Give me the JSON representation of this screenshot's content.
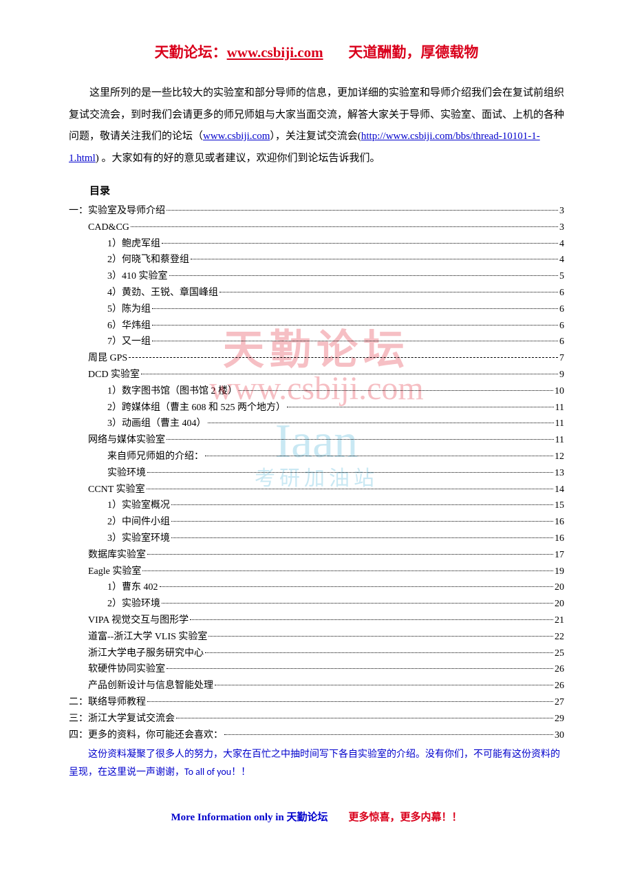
{
  "header": {
    "prefix": "天勤论坛：",
    "link_text": "www.csbiji.com",
    "motto": "天道酬勤，厚德载物"
  },
  "intro": {
    "text1": "这里所列的是一些比较大的实验室和部分导师的信息，更加详细的实验室和导师介绍我们会在复试前组织复试交流会，到时我们会请更多的师兄师姐与大家当面交流，解答大家关于导师、实验室、面试、上机的各种问题，敬请关注我们的论坛（",
    "link1": "www.csbiji.com",
    "text2": "），关注复试交流会(",
    "link2": "http://www.csbiji.com/bbs/thread-10101-1-1.html",
    "text3": ")  。大家如有的好的意见或者建议，欢迎你们到论坛告诉我们。"
  },
  "toc_title": "目录",
  "toc": [
    {
      "level": 0,
      "label": "一：实验室及导师介绍",
      "page": "3",
      "leader": "dot"
    },
    {
      "level": 1,
      "label": "CAD&CG",
      "page": "3",
      "leader": "dot"
    },
    {
      "level": 2,
      "label": "1）鲍虎军组",
      "page": "4",
      "leader": "dot"
    },
    {
      "level": 2,
      "label": "2）何晓飞和蔡登组",
      "page": "4",
      "leader": "dot"
    },
    {
      "level": 2,
      "label": "3）410 实验室",
      "page": "5",
      "leader": "dot"
    },
    {
      "level": 2,
      "label": "4）黄劲、王锐、章国峰组",
      "page": "6",
      "leader": "dot"
    },
    {
      "level": 2,
      "label": "5）陈为组",
      "page": "6",
      "leader": "dot"
    },
    {
      "level": 2,
      "label": "6）华炜组",
      "page": "6",
      "leader": "dot"
    },
    {
      "level": 2,
      "label": "7）又一组",
      "page": "6",
      "leader": "dot"
    },
    {
      "level": 1,
      "label": "周昆 GPS",
      "page": "7",
      "leader": "dash"
    },
    {
      "level": 1,
      "label": "DCD 实验室",
      "page": "9",
      "leader": "dot"
    },
    {
      "level": 2,
      "label": "1）数字图书馆（图书馆 2 楼）",
      "page": "10",
      "leader": "dot"
    },
    {
      "level": 2,
      "label": "2）跨媒体组（曹主 608 和 525 两个地方）",
      "page": "11",
      "leader": "dot"
    },
    {
      "level": 2,
      "label": "3）动画组（曹主 404）",
      "page": "11",
      "leader": "dot"
    },
    {
      "level": 1,
      "label": "网络与媒体实验室",
      "page": "11",
      "leader": "dot"
    },
    {
      "level": 2,
      "label": "来自师兄师姐的介绍：",
      "page": "12",
      "leader": "dot"
    },
    {
      "level": 2,
      "label": "实验环境",
      "page": "13",
      "leader": "dot"
    },
    {
      "level": 1,
      "label": "CCNT 实验室",
      "page": "14",
      "leader": "dot"
    },
    {
      "level": 2,
      "label": "1）实验室概况",
      "page": "15",
      "leader": "dot"
    },
    {
      "level": 2,
      "label": "2）中间件小组",
      "page": "16",
      "leader": "dot"
    },
    {
      "level": 2,
      "label": "3）实验室环境",
      "page": "16",
      "leader": "dot"
    },
    {
      "level": 1,
      "label": "数据库实验室",
      "page": "17",
      "leader": "dot"
    },
    {
      "level": 1,
      "label": "Eagle 实验室",
      "page": "19",
      "leader": "dot"
    },
    {
      "level": 2,
      "label": "1）曹东 402",
      "page": "20",
      "leader": "dot"
    },
    {
      "level": 2,
      "label": "2）实验环境",
      "page": "20",
      "leader": "dot"
    },
    {
      "level": 1,
      "label": "VIPA 视觉交互与图形学",
      "page": "21",
      "leader": "dot"
    },
    {
      "level": 1,
      "label": "道富--浙江大学 VLIS 实验室",
      "page": "22",
      "leader": "dot"
    },
    {
      "level": 1,
      "label": "浙江大学电子服务研究中心",
      "page": "25",
      "leader": "dot"
    },
    {
      "level": 1,
      "label": "软硬件协同实验室",
      "page": "26",
      "leader": "dot"
    },
    {
      "level": 1,
      "label": "产品创新设计与信息智能处理",
      "page": "26",
      "leader": "dot"
    },
    {
      "level": 0,
      "label": "二：联络导师教程",
      "page": "27",
      "leader": "dot"
    },
    {
      "level": 0,
      "label": "三：浙江大学复试交流会",
      "page": "29",
      "leader": "dot"
    },
    {
      "level": 0,
      "label": "四：更多的资料，你可能还会喜欢：",
      "page": "30",
      "leader": "dot"
    }
  ],
  "thanks": {
    "p1": "这份资料凝聚了很多人的努力，大家在百忙之中抽时间写下各自实验室的介绍。没有你们，不可能有这份资料的呈现，在这里说一声谢谢，",
    "p2": "To all of you！！"
  },
  "footer": {
    "left": "More Information only in  天勤论坛",
    "right": "更多惊喜，更多内幕！！"
  },
  "watermark": {
    "line1": "天勤论坛",
    "line2": "www.csbiji.com",
    "line3": "Iaan",
    "line4": "考研加油站"
  }
}
